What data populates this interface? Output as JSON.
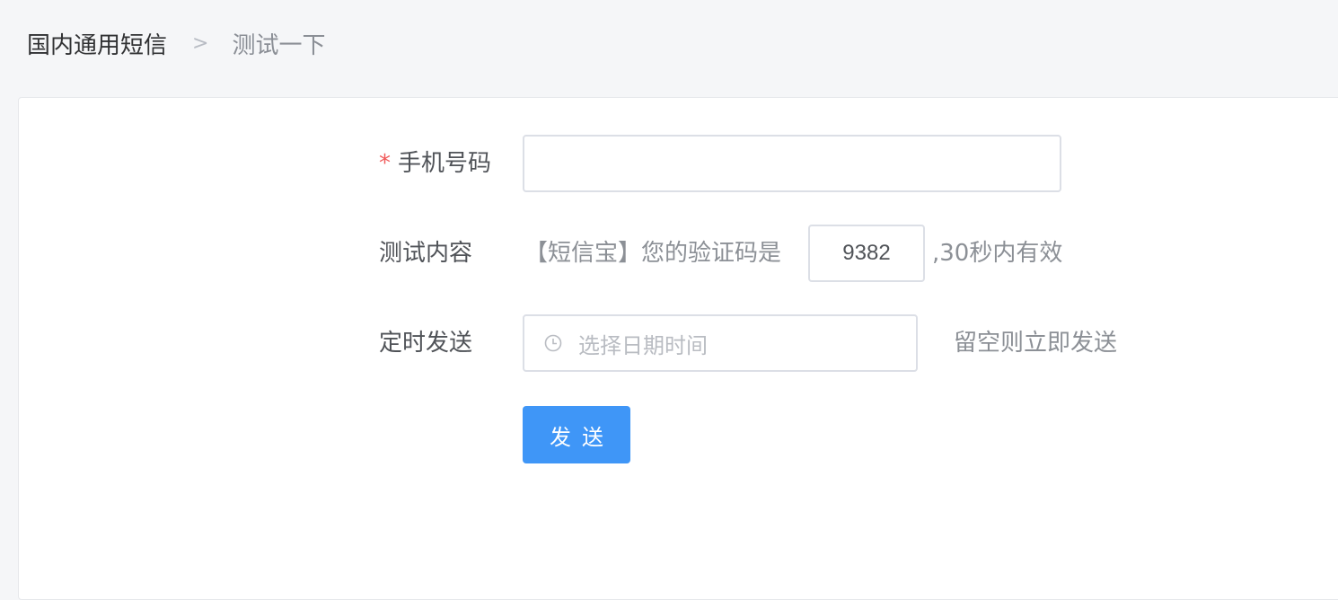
{
  "breadcrumb": {
    "first": "国内通用短信",
    "separator": ">",
    "current": "测试一下"
  },
  "form": {
    "phone": {
      "required_mark": "*",
      "label": "手机号码",
      "value": ""
    },
    "content": {
      "label": "测试内容",
      "prefix": "【短信宝】您的验证码是",
      "code": "9382",
      "suffix": ",30秒内有效"
    },
    "schedule": {
      "label": "定时发送",
      "icon": "clock-icon",
      "placeholder": "选择日期时间",
      "hint": "留空则立即发送"
    },
    "submit_label": "发送"
  },
  "colors": {
    "primary": "#3f96f7",
    "required": "#f05a5a",
    "border": "#dcdfe6",
    "page_bg": "#f5f6f8"
  }
}
